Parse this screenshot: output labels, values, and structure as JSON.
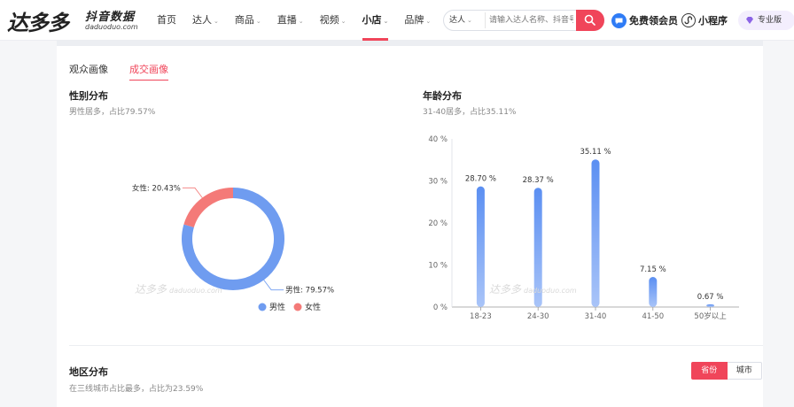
{
  "header": {
    "logo_main": "达多多",
    "logo_sub": "抖音数据",
    "logo_url": "daduoduo.com",
    "nav": [
      {
        "label": "首页",
        "has_menu": false,
        "active": false
      },
      {
        "label": "达人",
        "has_menu": true,
        "active": false
      },
      {
        "label": "商品",
        "has_menu": true,
        "active": false
      },
      {
        "label": "直播",
        "has_menu": true,
        "active": false
      },
      {
        "label": "视频",
        "has_menu": true,
        "active": false
      },
      {
        "label": "小店",
        "has_menu": true,
        "active": true
      },
      {
        "label": "品牌",
        "has_menu": true,
        "active": false
      }
    ],
    "search": {
      "type": "达人",
      "placeholder": "请输入达人名称、抖音号"
    },
    "vip_label": "免费领会员",
    "mini_label": "小程序",
    "pro_label": "专业版"
  },
  "tabs": [
    "观众画像",
    "成交画像"
  ],
  "active_tab": 1,
  "gender": {
    "title": "性别分布",
    "subtitle": "男性居多，占比79.57%",
    "legend": [
      "男性",
      "女性"
    ]
  },
  "age": {
    "title": "年龄分布",
    "subtitle": "31-40居多，占比35.11%"
  },
  "region": {
    "title": "地区分布",
    "subtitle": "在三线城市占比最多，占比为23.59%",
    "toggle": [
      "省份",
      "城市"
    ]
  },
  "watermark": {
    "main": "达多多",
    "url": "daduoduo.com"
  },
  "colors": {
    "accent": "#f0455a",
    "male": "#6f9cf0",
    "female": "#f47a78",
    "bar": "#5b8ff2"
  },
  "chart_data": [
    {
      "type": "pie",
      "title": "性别分布",
      "labels": [
        "男性",
        "女性"
      ],
      "values": [
        79.57,
        20.43
      ],
      "data_labels": [
        "男性: 79.57%",
        "女性: 20.43%"
      ],
      "legend": "bottom"
    },
    {
      "type": "bar",
      "title": "年龄分布",
      "categories": [
        "18-23",
        "24-30",
        "31-40",
        "41-50",
        "50岁以上"
      ],
      "values": [
        28.7,
        28.37,
        35.11,
        7.15,
        0.67
      ],
      "data_labels": [
        "28.70 %",
        "28.37 %",
        "35.11 %",
        "7.15 %",
        "0.67 %"
      ],
      "y_ticks": [
        "0 %",
        "10 %",
        "20 %",
        "30 %",
        "40 %"
      ],
      "ylim": [
        0,
        40
      ],
      "grid": false
    }
  ]
}
